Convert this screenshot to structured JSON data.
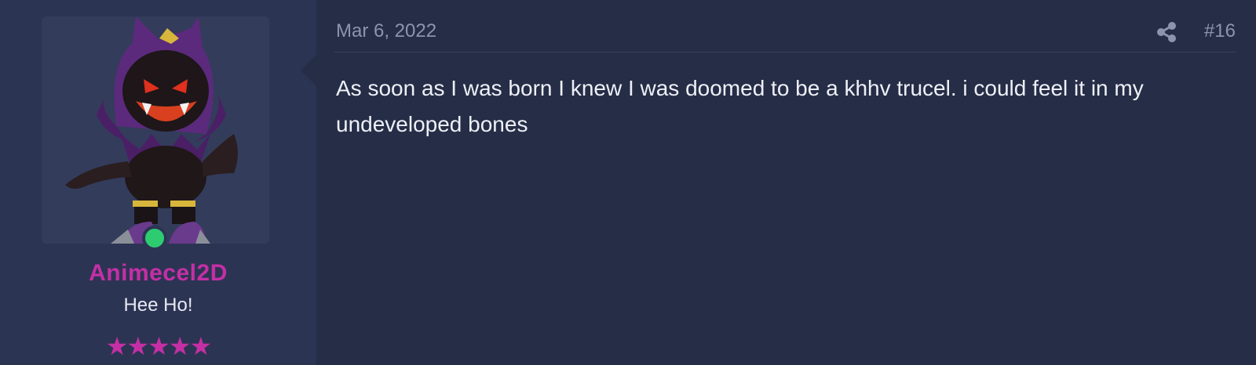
{
  "user": {
    "name": "Animecel2D",
    "title": "Hee Ho!",
    "rating": 5,
    "stars_display": "★★★★★",
    "online": true,
    "name_color": "#c42fa5",
    "online_color": "#2ecc71"
  },
  "post": {
    "date": "Mar 6, 2022",
    "number": "#16",
    "share_icon": "share-icon",
    "body": "As soon as I was born I knew I was doomed to be a khhv trucel. i could feel it in my undeveloped bones"
  }
}
